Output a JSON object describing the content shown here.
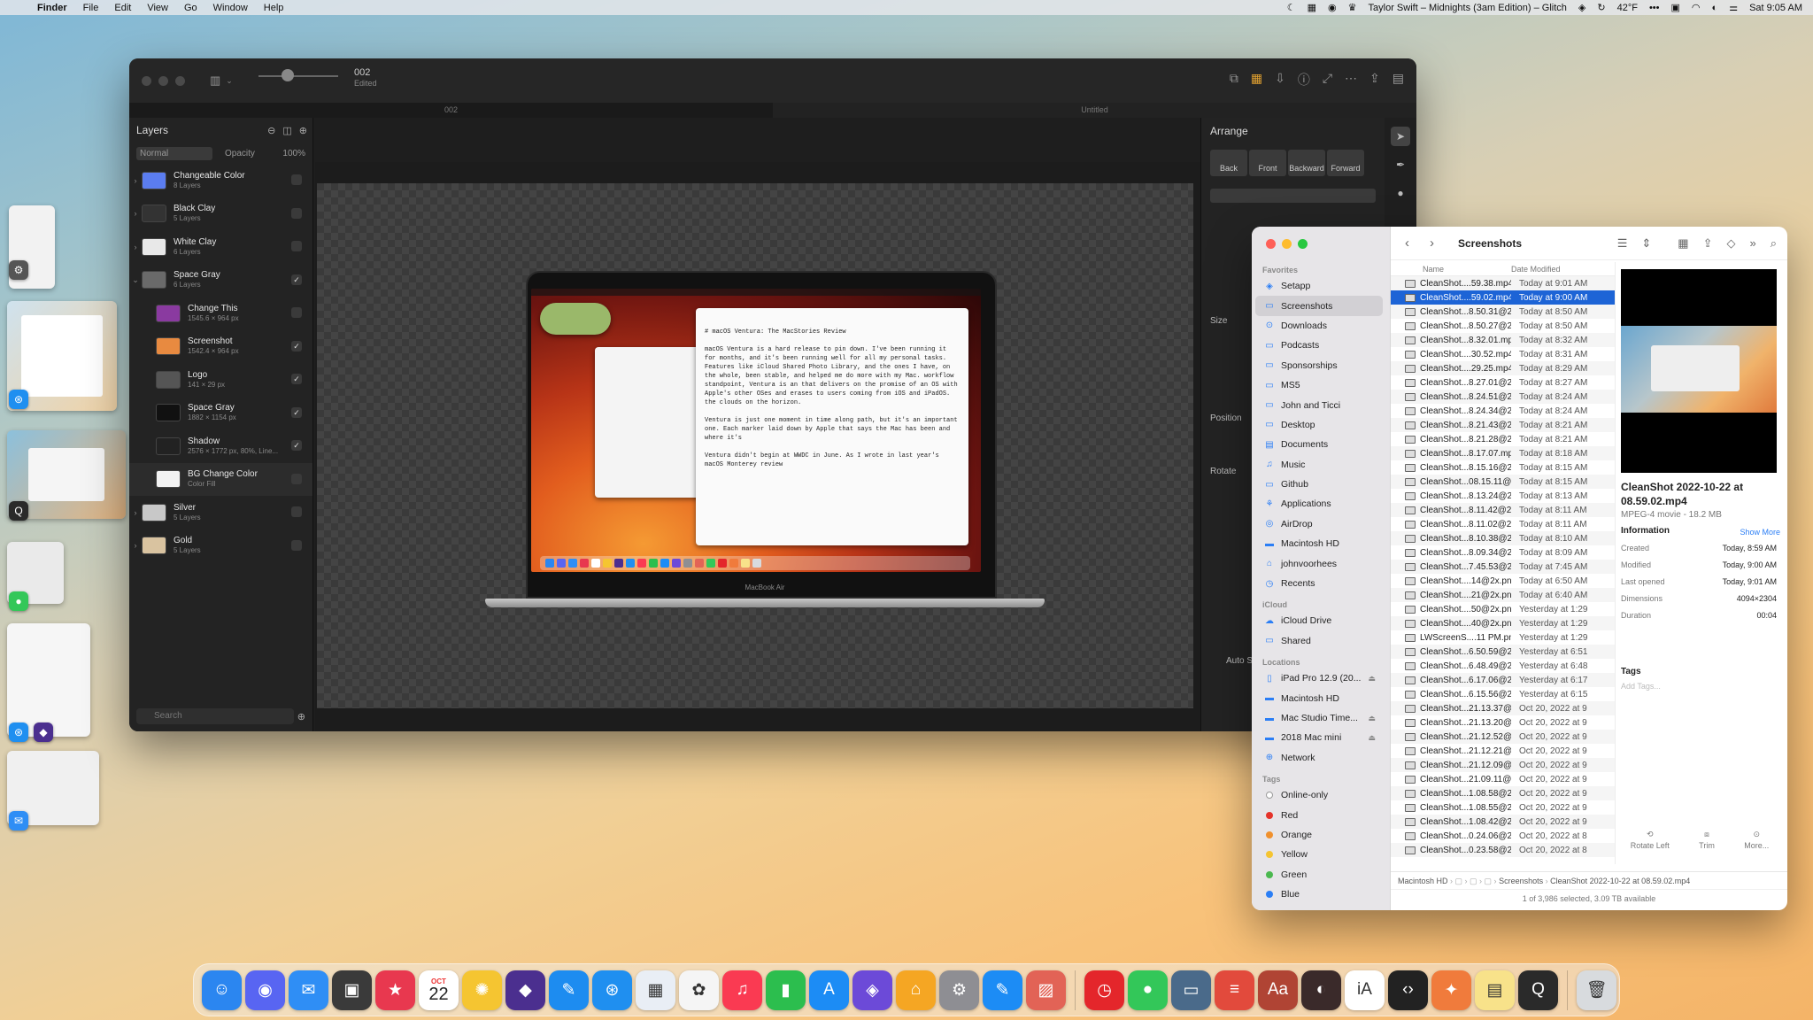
{
  "menubar": {
    "app": "Finder",
    "items": [
      "File",
      "Edit",
      "View",
      "Go",
      "Window",
      "Help"
    ],
    "now_playing": "Taylor Swift – Midnights (3am Edition) – Glitch",
    "weather": "42°F",
    "clock": "Sat 9:05 AM"
  },
  "editor": {
    "doc_name": "002",
    "doc_status": "Edited",
    "tabs": [
      "002",
      "Untitled"
    ],
    "layers_title": "Layers",
    "blend_mode": "Normal",
    "opacity_label": "Opacity",
    "opacity_value": "100%",
    "layers": [
      {
        "name": "Changeable Color",
        "sub": "8 Layers",
        "group": true,
        "checked": false,
        "color": "#5b7df0"
      },
      {
        "name": "Black Clay",
        "sub": "5 Layers",
        "group": true,
        "checked": false,
        "color": "#333333"
      },
      {
        "name": "White Clay",
        "sub": "6 Layers",
        "group": true,
        "checked": false,
        "color": "#e8e8e8"
      },
      {
        "name": "Space Gray",
        "sub": "6 Layers",
        "group": true,
        "open": true,
        "checked": true,
        "color": "#6a6a6a"
      },
      {
        "name": "Change This",
        "sub": "1545.6 × 964 px",
        "child": true,
        "checked": false,
        "color": "#8a3aa0"
      },
      {
        "name": "Screenshot",
        "sub": "1542.4 × 964 px",
        "child": true,
        "checked": true,
        "color": "#e88a40"
      },
      {
        "name": "Logo",
        "sub": "141 × 29 px",
        "child": true,
        "checked": true,
        "color": "#555555"
      },
      {
        "name": "Space Gray",
        "sub": "1882 × 1154 px",
        "child": true,
        "checked": true,
        "color": "#111111"
      },
      {
        "name": "Shadow",
        "sub": "2576 × 1772 px, 80%, Line...",
        "child": true,
        "checked": true,
        "color": "#222222"
      },
      {
        "name": "BG Change Color",
        "sub": "Color Fill",
        "child": true,
        "checked": false,
        "selected": true,
        "color": "#f2f2f2"
      },
      {
        "name": "Silver",
        "sub": "5 Layers",
        "group": true,
        "checked": false,
        "color": "#c8c8c8"
      },
      {
        "name": "Gold",
        "sub": "5 Layers",
        "group": true,
        "checked": false,
        "color": "#d9c3a0"
      }
    ],
    "search_placeholder": "Search",
    "laptop_label": "MacBook Air",
    "mini_doc": "# macOS Ventura: The MacStories Review\n\nmacOS Ventura is a hard release to pin down. I've been running it for months, and it's been running well for all my personal tasks. Features like iCloud Shared Photo Library, and the ones I have, on the whole, been stable, and helped me do more with my Mac. workflow standpoint, Ventura is an that delivers on the promise of an OS with Apple's other OSes and erases to users coming from iOS and iPadOS. the clouds on the horizon.\n\nVentura is just one moment in time along path, but it's an important one. Each marker laid down by Apple that says the Mac has been and where it's\n\nVentura didn't begin at WWDC in June. As I wrote in last year's macOS Monterey review",
    "arrange": {
      "title": "Arrange",
      "buttons": [
        "Back",
        "Front",
        "Backward",
        "Forward"
      ],
      "size_label": "Size",
      "position_label": "Position",
      "rotate_label": "Rotate",
      "auto_label": "Auto S"
    }
  },
  "finder": {
    "title": "Screenshots",
    "favorites_label": "Favorites",
    "favorites": [
      "Setapp",
      "Screenshots",
      "Downloads",
      "Podcasts",
      "Sponsorships",
      "MS5",
      "John and Ticci",
      "Desktop",
      "Documents",
      "Music",
      "Github",
      "Applications",
      "AirDrop",
      "Macintosh HD",
      "johnvoorhees",
      "Recents"
    ],
    "icloud_label": "iCloud",
    "icloud": [
      "iCloud Drive",
      "Shared"
    ],
    "locations_label": "Locations",
    "locations": [
      "iPad Pro 12.9 (20...",
      "Macintosh HD",
      "Mac Studio Time...",
      "2018 Mac mini",
      "Network"
    ],
    "tags_label": "Tags",
    "tags": [
      {
        "name": "Online-only",
        "color": "#ffffff"
      },
      {
        "name": "Red",
        "color": "#e5332a"
      },
      {
        "name": "Orange",
        "color": "#f0902d"
      },
      {
        "name": "Yellow",
        "color": "#f5c431"
      },
      {
        "name": "Green",
        "color": "#4bb84f"
      },
      {
        "name": "Blue",
        "color": "#2b7ef5"
      }
    ],
    "col_name": "Name",
    "col_date": "Date Modified",
    "files": [
      [
        "CleanShot....59.38.mp4",
        "Today at 9:01 AM"
      ],
      [
        "CleanShot....59.02.mp4",
        "Today at 9:00 AM"
      ],
      [
        "CleanShot...8.50.31@2x",
        "Today at 8:50 AM"
      ],
      [
        "CleanShot...8.50.27@2x",
        "Today at 8:50 AM"
      ],
      [
        "CleanShot...8.32.01.mp4",
        "Today at 8:32 AM"
      ],
      [
        "CleanShot....30.52.mp4",
        "Today at 8:31 AM"
      ],
      [
        "CleanShot....29.25.mp4",
        "Today at 8:29 AM"
      ],
      [
        "CleanShot...8.27.01@2x",
        "Today at 8:27 AM"
      ],
      [
        "CleanShot...8.24.51@2x",
        "Today at 8:24 AM"
      ],
      [
        "CleanShot...8.24.34@2x",
        "Today at 8:24 AM"
      ],
      [
        "CleanShot...8.21.43@2x",
        "Today at 8:21 AM"
      ],
      [
        "CleanShot...8.21.28@2x",
        "Today at 8:21 AM"
      ],
      [
        "CleanShot...8.17.07.mp4",
        "Today at 8:18 AM"
      ],
      [
        "CleanShot...8.15.16@2x",
        "Today at 8:15 AM"
      ],
      [
        "CleanShot...08.15.11@2x",
        "Today at 8:15 AM"
      ],
      [
        "CleanShot...8.13.24@2x",
        "Today at 8:13 AM"
      ],
      [
        "CleanShot...8.11.42@2x",
        "Today at 8:11 AM"
      ],
      [
        "CleanShot...8.11.02@2x",
        "Today at 8:11 AM"
      ],
      [
        "CleanShot...8.10.38@2x",
        "Today at 8:10 AM"
      ],
      [
        "CleanShot...8.09.34@2x",
        "Today at 8:09 AM"
      ],
      [
        "CleanShot...7.45.53@2x",
        "Today at 7:45 AM"
      ],
      [
        "CleanShot....14@2x.png",
        "Today at 6:50 AM"
      ],
      [
        "CleanShot....21@2x.png",
        "Today at 6:40 AM"
      ],
      [
        "CleanShot....50@2x.png",
        "Yesterday at 1:29"
      ],
      [
        "CleanShot....40@2x.png",
        "Yesterday at 1:29"
      ],
      [
        "LWScreenS....11 PM.png",
        "Yesterday at 1:29"
      ],
      [
        "CleanShot...6.50.59@2x",
        "Yesterday at 6:51"
      ],
      [
        "CleanShot...6.48.49@2x",
        "Yesterday at 6:48"
      ],
      [
        "CleanShot...6.17.06@2x",
        "Yesterday at 6:17"
      ],
      [
        "CleanShot...6.15.56@2x",
        "Yesterday at 6:15"
      ],
      [
        "CleanShot...21.13.37@2x",
        "Oct 20, 2022 at 9"
      ],
      [
        "CleanShot...21.13.20@2x",
        "Oct 20, 2022 at 9"
      ],
      [
        "CleanShot...21.12.52@2x",
        "Oct 20, 2022 at 9"
      ],
      [
        "CleanShot...21.12.21@2x",
        "Oct 20, 2022 at 9"
      ],
      [
        "CleanShot...21.12.09@2x",
        "Oct 20, 2022 at 9"
      ],
      [
        "CleanShot...21.09.11@2x",
        "Oct 20, 2022 at 9"
      ],
      [
        "CleanShot...1.08.58@2x",
        "Oct 20, 2022 at 9"
      ],
      [
        "CleanShot...1.08.55@2x",
        "Oct 20, 2022 at 9"
      ],
      [
        "CleanShot...1.08.42@2x",
        "Oct 20, 2022 at 9"
      ],
      [
        "CleanShot...0.24.06@2x",
        "Oct 20, 2022 at 8"
      ],
      [
        "CleanShot...0.23.58@2x",
        "Oct 20, 2022 at 8"
      ]
    ],
    "selected_index": 1,
    "preview": {
      "title": "CleanShot 2022-10-22 at 08.59.02.mp4",
      "meta": "MPEG-4 movie - 18.2 MB",
      "info_label": "Information",
      "show_more": "Show More",
      "info": [
        [
          "Created",
          "Today, 8:59 AM"
        ],
        [
          "Modified",
          "Today, 9:00 AM"
        ],
        [
          "Last opened",
          "Today, 9:01 AM"
        ],
        [
          "Dimensions",
          "4094×2304"
        ],
        [
          "Duration",
          "00:04"
        ]
      ],
      "tags_label": "Tags",
      "tags_placeholder": "Add Tags...",
      "actions": [
        "Rotate Left",
        "Trim",
        "More..."
      ]
    },
    "path": [
      "Macintosh HD",
      "Screenshots",
      "CleanShot 2022-10-22 at 08.59.02.mp4"
    ],
    "status": "1 of 3,986 selected, 3.09 TB available"
  },
  "dock": {
    "calendar_month": "OCT",
    "calendar_day": "22",
    "apps": [
      {
        "name": "finder",
        "color": "#2b86f0",
        "glyph": "☺"
      },
      {
        "name": "discord",
        "color": "#5865f2",
        "glyph": "◉"
      },
      {
        "name": "mail",
        "color": "#2f8ef5",
        "glyph": "✉"
      },
      {
        "name": "craft",
        "color": "#3a3a3a",
        "glyph": "▣"
      },
      {
        "name": "goodlinks",
        "color": "#e8384f",
        "glyph": "★"
      },
      {
        "name": "calendar",
        "color": "#ffffff",
        "glyph": ""
      },
      {
        "name": "brain",
        "color": "#f5c531",
        "glyph": "✺"
      },
      {
        "name": "obsidian",
        "color": "#4b2f8f",
        "glyph": "◆"
      },
      {
        "name": "quill",
        "color": "#1d8cf0",
        "glyph": "✎"
      },
      {
        "name": "safari",
        "color": "#1f8ff0",
        "glyph": "⊛"
      },
      {
        "name": "launchpad",
        "color": "#e9eef5",
        "glyph": "▦"
      },
      {
        "name": "photos",
        "color": "#f5f5f5",
        "glyph": "✿"
      },
      {
        "name": "music",
        "color": "#fa3a52",
        "glyph": "♫"
      },
      {
        "name": "numbers",
        "color": "#2cbe4e",
        "glyph": "▮"
      },
      {
        "name": "app-store",
        "color": "#1c8cf5",
        "glyph": "A"
      },
      {
        "name": "shortcuts",
        "color": "#6c4ad8",
        "glyph": "◈"
      },
      {
        "name": "home",
        "color": "#f5a623",
        "glyph": "⌂"
      },
      {
        "name": "system-settings",
        "color": "#8e8e93",
        "glyph": "⚙"
      },
      {
        "name": "pages",
        "color": "#1c8cf5",
        "glyph": "✎"
      },
      {
        "name": "preview",
        "color": "#e26356",
        "glyph": "▨"
      },
      {
        "name": "timing",
        "color": "#e4262b",
        "glyph": "◷"
      },
      {
        "name": "messages",
        "color": "#33c759",
        "glyph": "●"
      },
      {
        "name": "capture",
        "color": "#4a6a8a",
        "glyph": "▭"
      },
      {
        "name": "mela",
        "color": "#e24a3c",
        "glyph": "≡"
      },
      {
        "name": "dictionary",
        "color": "#b04434",
        "glyph": "Aa"
      },
      {
        "name": "photo-app",
        "color": "#3a2a2a",
        "glyph": "◐"
      },
      {
        "name": "ia-writer",
        "color": "#ffffff",
        "glyph": "iA"
      },
      {
        "name": "script-editor",
        "color": "#222222",
        "glyph": "‹›"
      },
      {
        "name": "pixelmator",
        "color": "#f07b3c",
        "glyph": "✦"
      },
      {
        "name": "notes",
        "color": "#f8e28a",
        "glyph": "▤"
      },
      {
        "name": "quicktime",
        "color": "#2a2a2a",
        "glyph": "Q"
      },
      {
        "name": "trash",
        "color": "#d8dbde",
        "glyph": "🗑"
      }
    ]
  }
}
